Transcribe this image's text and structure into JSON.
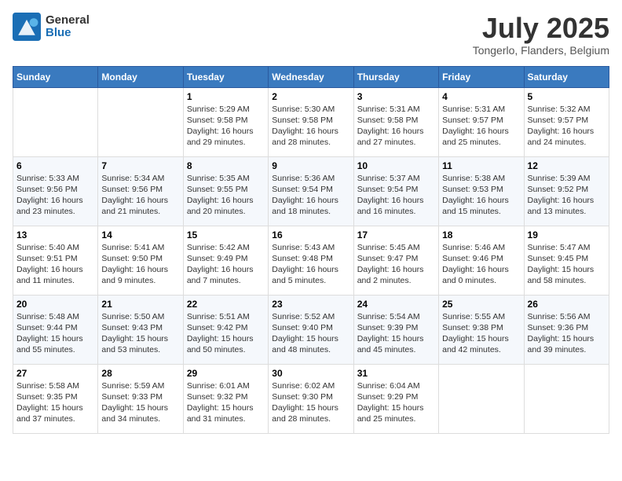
{
  "header": {
    "logo_line1": "General",
    "logo_line2": "Blue",
    "month_year": "July 2025",
    "location": "Tongerlo, Flanders, Belgium"
  },
  "weekdays": [
    "Sunday",
    "Monday",
    "Tuesday",
    "Wednesday",
    "Thursday",
    "Friday",
    "Saturday"
  ],
  "weeks": [
    [
      {
        "day": "",
        "content": ""
      },
      {
        "day": "",
        "content": ""
      },
      {
        "day": "1",
        "content": "Sunrise: 5:29 AM\nSunset: 9:58 PM\nDaylight: 16 hours\nand 29 minutes."
      },
      {
        "day": "2",
        "content": "Sunrise: 5:30 AM\nSunset: 9:58 PM\nDaylight: 16 hours\nand 28 minutes."
      },
      {
        "day": "3",
        "content": "Sunrise: 5:31 AM\nSunset: 9:58 PM\nDaylight: 16 hours\nand 27 minutes."
      },
      {
        "day": "4",
        "content": "Sunrise: 5:31 AM\nSunset: 9:57 PM\nDaylight: 16 hours\nand 25 minutes."
      },
      {
        "day": "5",
        "content": "Sunrise: 5:32 AM\nSunset: 9:57 PM\nDaylight: 16 hours\nand 24 minutes."
      }
    ],
    [
      {
        "day": "6",
        "content": "Sunrise: 5:33 AM\nSunset: 9:56 PM\nDaylight: 16 hours\nand 23 minutes."
      },
      {
        "day": "7",
        "content": "Sunrise: 5:34 AM\nSunset: 9:56 PM\nDaylight: 16 hours\nand 21 minutes."
      },
      {
        "day": "8",
        "content": "Sunrise: 5:35 AM\nSunset: 9:55 PM\nDaylight: 16 hours\nand 20 minutes."
      },
      {
        "day": "9",
        "content": "Sunrise: 5:36 AM\nSunset: 9:54 PM\nDaylight: 16 hours\nand 18 minutes."
      },
      {
        "day": "10",
        "content": "Sunrise: 5:37 AM\nSunset: 9:54 PM\nDaylight: 16 hours\nand 16 minutes."
      },
      {
        "day": "11",
        "content": "Sunrise: 5:38 AM\nSunset: 9:53 PM\nDaylight: 16 hours\nand 15 minutes."
      },
      {
        "day": "12",
        "content": "Sunrise: 5:39 AM\nSunset: 9:52 PM\nDaylight: 16 hours\nand 13 minutes."
      }
    ],
    [
      {
        "day": "13",
        "content": "Sunrise: 5:40 AM\nSunset: 9:51 PM\nDaylight: 16 hours\nand 11 minutes."
      },
      {
        "day": "14",
        "content": "Sunrise: 5:41 AM\nSunset: 9:50 PM\nDaylight: 16 hours\nand 9 minutes."
      },
      {
        "day": "15",
        "content": "Sunrise: 5:42 AM\nSunset: 9:49 PM\nDaylight: 16 hours\nand 7 minutes."
      },
      {
        "day": "16",
        "content": "Sunrise: 5:43 AM\nSunset: 9:48 PM\nDaylight: 16 hours\nand 5 minutes."
      },
      {
        "day": "17",
        "content": "Sunrise: 5:45 AM\nSunset: 9:47 PM\nDaylight: 16 hours\nand 2 minutes."
      },
      {
        "day": "18",
        "content": "Sunrise: 5:46 AM\nSunset: 9:46 PM\nDaylight: 16 hours\nand 0 minutes."
      },
      {
        "day": "19",
        "content": "Sunrise: 5:47 AM\nSunset: 9:45 PM\nDaylight: 15 hours\nand 58 minutes."
      }
    ],
    [
      {
        "day": "20",
        "content": "Sunrise: 5:48 AM\nSunset: 9:44 PM\nDaylight: 15 hours\nand 55 minutes."
      },
      {
        "day": "21",
        "content": "Sunrise: 5:50 AM\nSunset: 9:43 PM\nDaylight: 15 hours\nand 53 minutes."
      },
      {
        "day": "22",
        "content": "Sunrise: 5:51 AM\nSunset: 9:42 PM\nDaylight: 15 hours\nand 50 minutes."
      },
      {
        "day": "23",
        "content": "Sunrise: 5:52 AM\nSunset: 9:40 PM\nDaylight: 15 hours\nand 48 minutes."
      },
      {
        "day": "24",
        "content": "Sunrise: 5:54 AM\nSunset: 9:39 PM\nDaylight: 15 hours\nand 45 minutes."
      },
      {
        "day": "25",
        "content": "Sunrise: 5:55 AM\nSunset: 9:38 PM\nDaylight: 15 hours\nand 42 minutes."
      },
      {
        "day": "26",
        "content": "Sunrise: 5:56 AM\nSunset: 9:36 PM\nDaylight: 15 hours\nand 39 minutes."
      }
    ],
    [
      {
        "day": "27",
        "content": "Sunrise: 5:58 AM\nSunset: 9:35 PM\nDaylight: 15 hours\nand 37 minutes."
      },
      {
        "day": "28",
        "content": "Sunrise: 5:59 AM\nSunset: 9:33 PM\nDaylight: 15 hours\nand 34 minutes."
      },
      {
        "day": "29",
        "content": "Sunrise: 6:01 AM\nSunset: 9:32 PM\nDaylight: 15 hours\nand 31 minutes."
      },
      {
        "day": "30",
        "content": "Sunrise: 6:02 AM\nSunset: 9:30 PM\nDaylight: 15 hours\nand 28 minutes."
      },
      {
        "day": "31",
        "content": "Sunrise: 6:04 AM\nSunset: 9:29 PM\nDaylight: 15 hours\nand 25 minutes."
      },
      {
        "day": "",
        "content": ""
      },
      {
        "day": "",
        "content": ""
      }
    ]
  ]
}
